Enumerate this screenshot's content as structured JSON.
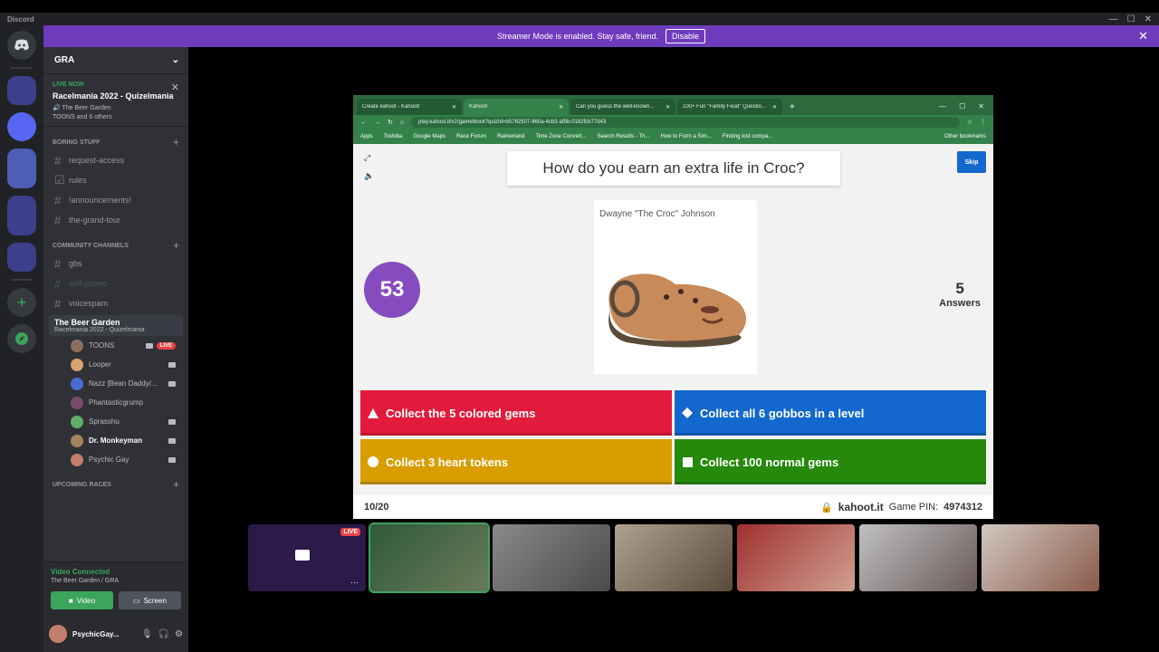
{
  "window": {
    "app_title": "Discord",
    "controls": [
      "—",
      "☐",
      "✕"
    ]
  },
  "banner": {
    "text": "Streamer Mode is enabled. Stay safe, friend.",
    "disable_label": "Disable"
  },
  "guild": {
    "name": "GRA"
  },
  "live": {
    "label": "LIVE NOW",
    "title": "Racelmania 2022 - Quizelmania",
    "location": "The Beer Garden",
    "watchers": "TOONS and 6 others"
  },
  "categories": {
    "boring": "BORING STUFF",
    "community": "COMMUNITY CHANNELS",
    "upcoming": "UPCOMING RACES"
  },
  "channels_boring": [
    "request-access",
    "rules",
    "!announcements!",
    "the-grand-tour"
  ],
  "channels_community": [
    "gbs",
    "self-promo",
    "voicespam"
  ],
  "voice_channel": {
    "name": "The Beer Garden",
    "subtitle": "Racelmania 2022 - Quizelmania"
  },
  "voice_users": [
    {
      "name": "TOONS",
      "live": "LIVE"
    },
    {
      "name": "Looper"
    },
    {
      "name": "Nazz [Bean Daddy/..."
    },
    {
      "name": "Phantasticgrump"
    },
    {
      "name": "Sprasshu"
    },
    {
      "name": "Dr. Monkeyman"
    },
    {
      "name": "Psychic Gay"
    }
  ],
  "rtc": {
    "status": "Video Connected",
    "location": "The Beer Garden / GRA",
    "video_label": "Video",
    "screen_label": "Screen"
  },
  "user": {
    "name": "PsychicGay..."
  },
  "browser": {
    "tabs": [
      "Create kahoot - Kahoot!",
      "Kahoot!",
      "Can you guess the well-known...",
      "100+ Fun \"Family Feud\" Questio..."
    ],
    "url": "play.kahoot.it/v2/gameblock?quizId=b5762507-860a-4cb3-af5b-0182fcb77d43",
    "bookmarks": [
      "Apps",
      "Toshiba",
      "Google Maps",
      "Race Forum",
      "Rainierland",
      "Time Zone Convert...",
      "Search Results - Th...",
      "How to Form a Sim...",
      "Finding lost compa..."
    ],
    "other_bookmarks": "Other bookmarks"
  },
  "kahoot": {
    "question": "How do you earn an extra life in Croc?",
    "skip_label": "Skip",
    "timer": "53",
    "answers_count": "5",
    "answers_label": "Answers",
    "image_caption": "Dwayne \"The Croc\" Johnson",
    "choices": [
      "Collect the 5 colored gems",
      "Collect all 6 gobbos in a level",
      "Collect 3 heart tokens",
      "Collect 100 normal gems"
    ],
    "progress": "10/20",
    "site": "kahoot.it",
    "pin_label": "Game PIN:",
    "pin": "4974312"
  },
  "video_strip": {
    "screen_live": "LIVE"
  },
  "colors": {
    "kahoot_red": "#e21b3c",
    "kahoot_blue": "#1368ce",
    "kahoot_yellow": "#d89e00",
    "kahoot_green": "#26890c",
    "kahoot_purple": "#864cbf",
    "discord_green": "#3ba55c",
    "streamer_purple": "#6f3bbd"
  }
}
